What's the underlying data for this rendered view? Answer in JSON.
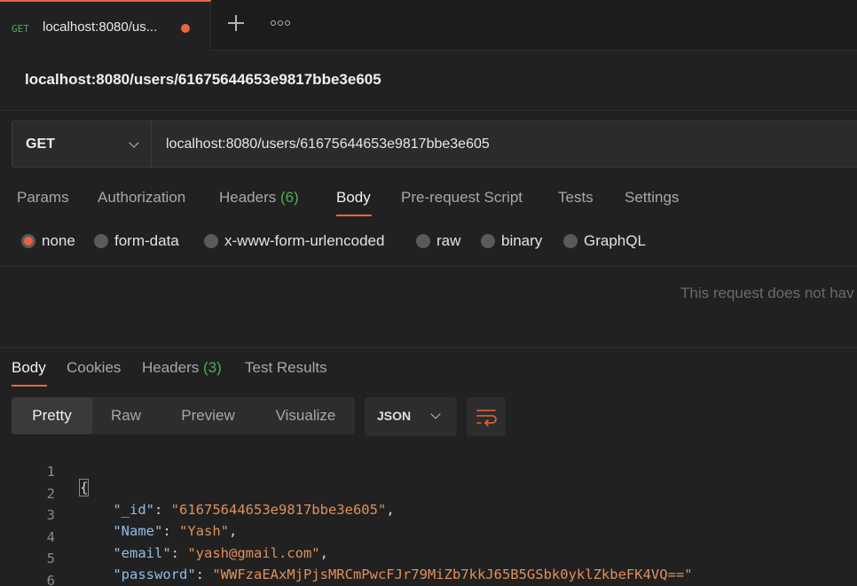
{
  "tab": {
    "method": "GET",
    "title": "localhost:8080/us...",
    "unsaved": true
  },
  "request": {
    "title": "localhost:8080/users/61675644653e9817bbe3e605",
    "method": "GET",
    "url": "localhost:8080/users/61675644653e9817bbe3e605"
  },
  "request_tabs": [
    {
      "label": "Params"
    },
    {
      "label": "Authorization"
    },
    {
      "label": "Headers",
      "count": "(6)"
    },
    {
      "label": "Body",
      "active": true
    },
    {
      "label": "Pre-request Script"
    },
    {
      "label": "Tests"
    },
    {
      "label": "Settings"
    }
  ],
  "body_types": [
    {
      "label": "none",
      "selected": true
    },
    {
      "label": "form-data"
    },
    {
      "label": "x-www-form-urlencoded"
    },
    {
      "label": "raw"
    },
    {
      "label": "binary"
    },
    {
      "label": "GraphQL"
    }
  ],
  "empty_body_message": "This request does not hav",
  "response_tabs": [
    {
      "label": "Body",
      "active": true
    },
    {
      "label": "Cookies"
    },
    {
      "label": "Headers",
      "count": "(3)"
    },
    {
      "label": "Test Results"
    }
  ],
  "view_modes": [
    {
      "label": "Pretty",
      "active": true
    },
    {
      "label": "Raw"
    },
    {
      "label": "Preview"
    },
    {
      "label": "Visualize"
    }
  ],
  "format": "JSON",
  "response_lines": [
    {
      "n": "1",
      "open": "{"
    },
    {
      "n": "2",
      "key": "\"_id\"",
      "value": "\"61675644653e9817bbe3e605\"",
      "comma": ","
    },
    {
      "n": "3",
      "key": "\"Name\"",
      "value": "\"Yash\"",
      "comma": ","
    },
    {
      "n": "4",
      "key": "\"email\"",
      "value": "\"yash@gmail.com\"",
      "comma": ","
    },
    {
      "n": "5",
      "key": "\"password\"",
      "value": "\"WWFzaEAxMjPjsMRCmPwcFJr79MiZb7kkJ65B5GSbk0yklZkbeFK4VQ==\"",
      "comma": ""
    },
    {
      "n": "6",
      "close": "}"
    }
  ],
  "colors": {
    "accent": "#e8663d",
    "method_get": "#4caf50",
    "json_key": "#8fbde8",
    "json_string": "#e08f5a"
  },
  "icons": {
    "new_tab": "plus-icon",
    "more": "more-icon",
    "wrap": "wrap-lines-icon"
  }
}
